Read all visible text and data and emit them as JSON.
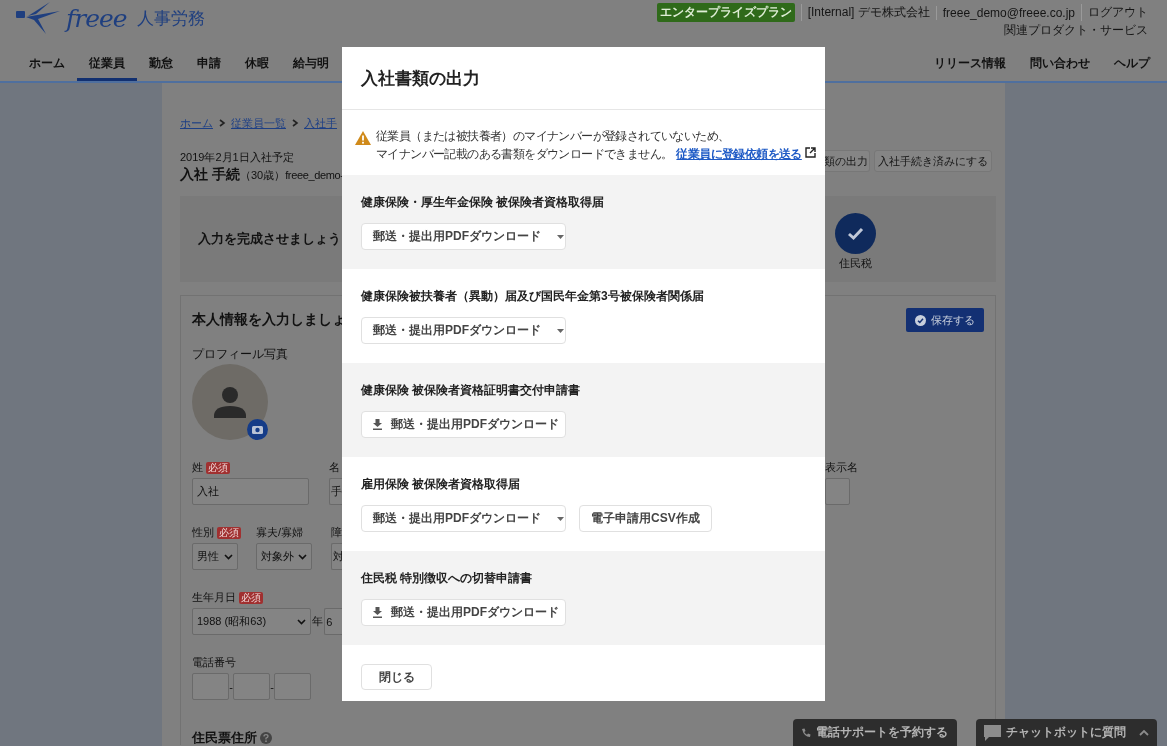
{
  "header": {
    "logo": {
      "wordmark": "freee",
      "product": "人事労務"
    },
    "plan_badge": "エンタープライズプラン",
    "account_links": [
      "[Internal] デモ株式会社",
      "freee_demo@freee.co.jp",
      "ログアウト"
    ],
    "related_link": "関連プロダクト・サービス",
    "nav_tabs": [
      {
        "label": "ホーム",
        "selected": false
      },
      {
        "label": "従業員",
        "selected": true
      },
      {
        "label": "勤怠",
        "selected": false
      },
      {
        "label": "申請",
        "selected": false
      },
      {
        "label": "休暇",
        "selected": false
      },
      {
        "label": "給与明",
        "selected": false
      }
    ],
    "nav_right": [
      "リリース情報",
      "問い合わせ",
      "ヘルプ"
    ]
  },
  "page": {
    "breadcrumbs": [
      "ホーム",
      "従業員一覧",
      "入社手"
    ],
    "entry_date": "2019年2月1日入社予定",
    "name": "入社 手続",
    "age": "（30歳）",
    "email": "freee_demo-",
    "action_buttons": [
      "類の出力",
      "入社手続き済みにする"
    ],
    "progress": {
      "prompt": "入力を完成させましょう",
      "steps": [
        {
          "label": "住民税",
          "done": true
        }
      ]
    },
    "form": {
      "title": "本人情報を入力しましょ",
      "save_button": "保存する",
      "photo_label": "プロフィール写真",
      "fields": [
        {
          "kind": "input",
          "label": "姓",
          "badge": "必須",
          "value": "入社"
        },
        {
          "kind": "input",
          "label": "名",
          "value": "手"
        },
        {
          "kind": "input",
          "label": "表示名"
        },
        {
          "kind": "select",
          "label": "性別",
          "badge": "必須",
          "value": "男性"
        },
        {
          "kind": "select",
          "label": "寡夫/寡婦",
          "value": "対象外"
        },
        {
          "kind": "select",
          "label": "障",
          "value": "対"
        },
        {
          "kind": "year",
          "label": "生年月日",
          "badge": "必須",
          "value": "1988 (昭和63)",
          "suffix": "年",
          "next_value": "6"
        },
        {
          "kind": "phone",
          "label": "電話番号",
          "separators": [
            "-",
            "-"
          ]
        }
      ],
      "section_heading": "住民票住所"
    }
  },
  "modal": {
    "title": "入社書類の出力",
    "notice": {
      "lines": [
        "従業員（または被扶養者）のマイナンバーが登録されていないため、",
        "マイナンバー記載のある書類をダウンロードできません。"
      ],
      "link": "従業員に登録依頼を送る"
    },
    "sections": [
      {
        "title": "健康保険・厚生年金保険 被保険者資格取得届",
        "buttons": [
          {
            "kind": "dropdown",
            "label": "郵送・提出用PDFダウンロード"
          }
        ]
      },
      {
        "title": "健康保険被扶養者（異動）届及び国民年金第3号被保険者関係届",
        "buttons": [
          {
            "kind": "dropdown",
            "label": "郵送・提出用PDFダウンロード"
          }
        ]
      },
      {
        "title": "健康保険 被保険者資格証明書交付申請書",
        "buttons": [
          {
            "kind": "download",
            "label": "郵送・提出用PDFダウンロード"
          }
        ]
      },
      {
        "title": "雇用保険 被保険者資格取得届",
        "buttons": [
          {
            "kind": "dropdown",
            "label": "郵送・提出用PDFダウンロード"
          },
          {
            "kind": "plain",
            "label": "電子申請用CSV作成"
          }
        ]
      },
      {
        "title": "住民税 特別徴収への切替申請書",
        "buttons": [
          {
            "kind": "download",
            "label": "郵送・提出用PDFダウンロード"
          }
        ]
      }
    ],
    "close_button": "閉じる"
  },
  "floating_buttons": [
    {
      "kind": "phone",
      "label": "電話サポートを予約する"
    },
    {
      "kind": "chat",
      "label": "チャットボットに質問"
    }
  ]
}
